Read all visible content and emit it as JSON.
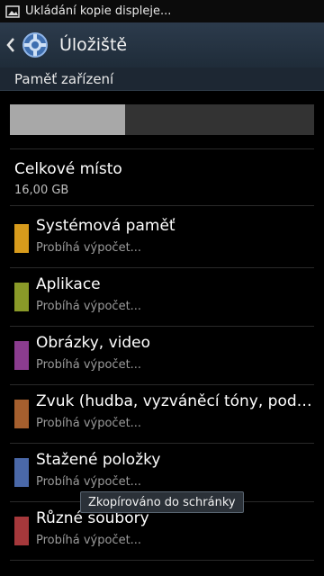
{
  "status_bar": {
    "notification_text": "Ukládání kopie displeje..."
  },
  "action_bar": {
    "title": "Úložiště"
  },
  "section": {
    "header": "Paměť zařízení"
  },
  "usage": {
    "used_fraction": 0.38
  },
  "total": {
    "label": "Celkové místo",
    "value": "16,00 GB"
  },
  "categories": [
    {
      "label": "Systémová paměť",
      "status": "Probíhá výpočet...",
      "color": "#d79b1c"
    },
    {
      "label": "Aplikace",
      "status": "Probíhá výpočet...",
      "color": "#8a9a28"
    },
    {
      "label": "Obrázky, video",
      "status": "Probíhá výpočet...",
      "color": "#8b3c8f"
    },
    {
      "label": "Zvuk (hudba, vyzváněcí tóny, podca...",
      "status": "Probíhá výpočet...",
      "color": "#a55f2e"
    },
    {
      "label": "Stažené položky",
      "status": "Probíhá výpočet...",
      "color": "#4a68a8"
    },
    {
      "label": "Různé soubory",
      "status": "Probíhá výpočet...",
      "color": "#a5383b"
    }
  ],
  "toast": {
    "text": "Zkopírováno do schránky"
  }
}
